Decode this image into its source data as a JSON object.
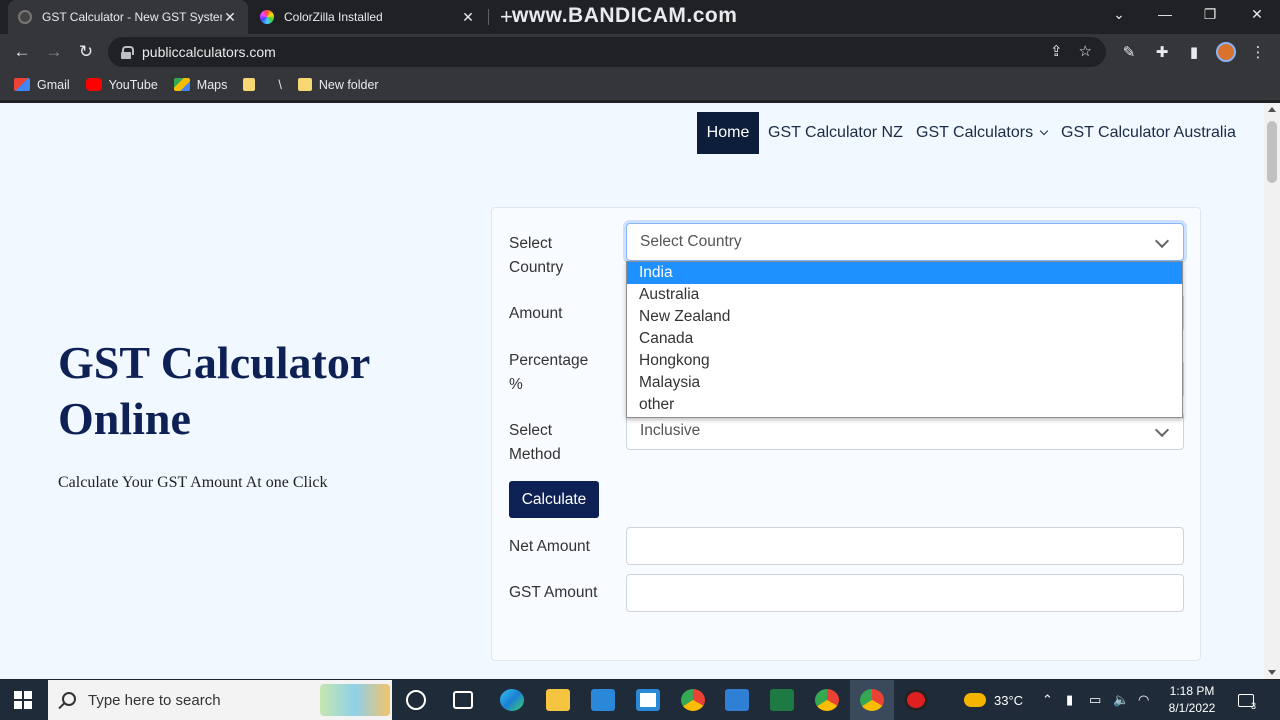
{
  "browser": {
    "tabs": [
      {
        "title": "GST Calculator - New GST System",
        "active": true
      },
      {
        "title": "ColorZilla Installed",
        "active": false
      }
    ],
    "new_tab_glyph": "+",
    "watermark": "www.BANDICAM.com",
    "url": "publiccalculators.com",
    "bookmarks": [
      {
        "label": "Gmail",
        "icon": "gmail-icon"
      },
      {
        "label": "YouTube",
        "icon": "youtube-icon"
      },
      {
        "label": "Maps",
        "icon": "maps-icon"
      },
      {
        "label": "",
        "icon": "folder-icon"
      },
      {
        "label": "\\",
        "icon": "folder-icon"
      },
      {
        "label": "New folder",
        "icon": "folder-icon"
      }
    ]
  },
  "nav": {
    "home": "Home",
    "nz": "GST Calculator NZ",
    "calculators": "GST Calculators",
    "australia": "GST Calculator Australia"
  },
  "hero": {
    "title": "GST Calculator Online",
    "subtitle": "Calculate Your GST Amount At one Click"
  },
  "form": {
    "country_label": "Select Country",
    "country_placeholder": "Select Country",
    "amount_label": "Amount",
    "percentage_label": "Percentage %",
    "method_label": "Select Method",
    "method_value": "Inclusive",
    "calculate": "Calculate",
    "net_label": "Net Amount",
    "gst_label": "GST Amount",
    "net_value": "",
    "gst_value": ""
  },
  "dropdown": {
    "options": [
      "India",
      "Australia",
      "New Zealand",
      "Canada",
      "Hongkong",
      "Malaysia",
      "other"
    ],
    "highlighted": "India"
  },
  "taskbar": {
    "search_placeholder": "Type here to search",
    "temperature": "33°C",
    "time": "1:18 PM",
    "date": "8/1/2022",
    "notification_count": "3"
  }
}
